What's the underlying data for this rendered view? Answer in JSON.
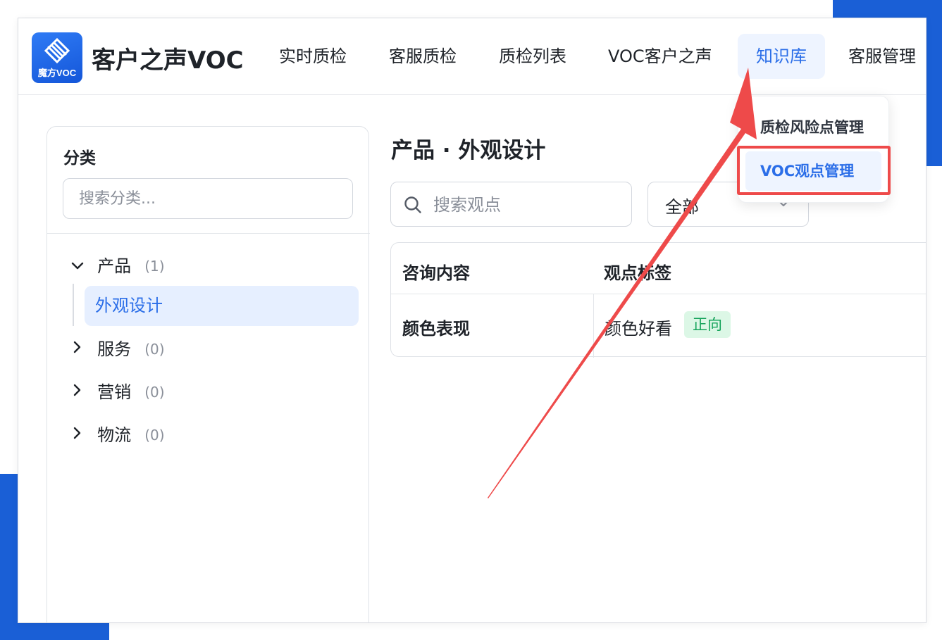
{
  "app": {
    "logo_text": "魔方VOC",
    "title": "客户之声VOC"
  },
  "nav": {
    "items": [
      {
        "label": "实时质检"
      },
      {
        "label": "客服质检"
      },
      {
        "label": "质检列表"
      },
      {
        "label": "VOC客户之声"
      },
      {
        "label": "知识库",
        "active": true
      },
      {
        "label": "客服管理"
      }
    ]
  },
  "dropdown": {
    "items": [
      {
        "label": "质检风险点管理"
      },
      {
        "label": "VOC观点管理",
        "highlighted": true
      }
    ]
  },
  "sidebar": {
    "title": "分类",
    "search_placeholder": "搜索分类...",
    "tree": [
      {
        "label": "产品",
        "count": "(1)",
        "expanded": true,
        "children": [
          {
            "label": "外观设计",
            "selected": true
          }
        ]
      },
      {
        "label": "服务",
        "count": "(0)",
        "expanded": false
      },
      {
        "label": "营销",
        "count": "(0)",
        "expanded": false
      },
      {
        "label": "物流",
        "count": "(0)",
        "expanded": false
      }
    ]
  },
  "main": {
    "heading": "产品 · 外观设计",
    "search_placeholder": "搜索观点",
    "filter_value": "全部",
    "table": {
      "columns": [
        "咨询内容",
        "观点标签"
      ],
      "rows": [
        {
          "content": "颜色表现",
          "viewpoint": "颜色好看",
          "sentiment": "正向"
        }
      ]
    }
  },
  "colors": {
    "accent": "#2b6ee8",
    "frame_blue": "#1a5fd6",
    "annotation_red": "#ee4a4a",
    "positive_tag_bg": "#dcf7e6",
    "positive_tag_text": "#14a35a"
  },
  "icons": [
    "logo-icon",
    "search-icon",
    "chevron-down-icon",
    "chevron-right-icon",
    "annotation-arrow"
  ]
}
